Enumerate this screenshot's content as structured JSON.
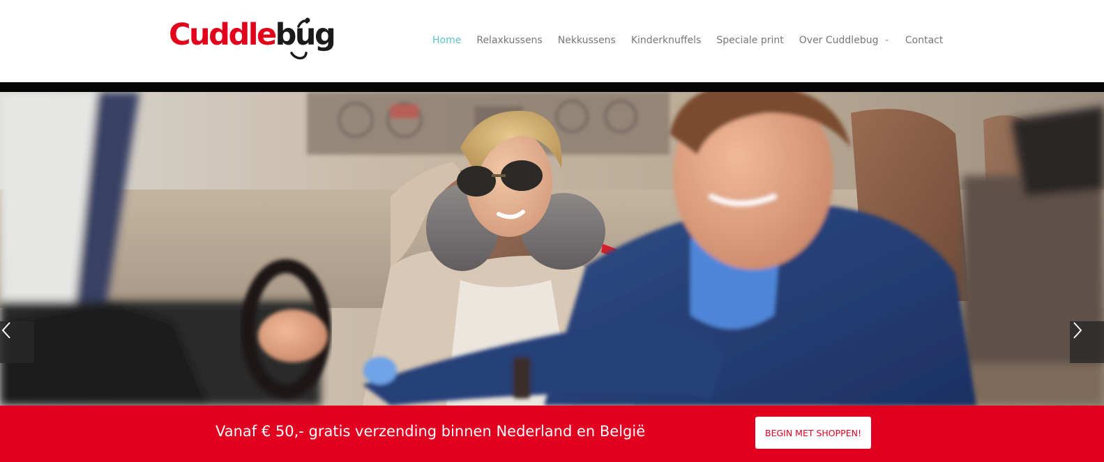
{
  "brand": {
    "logo_part1": "Cuddle",
    "logo_part2": "bug",
    "color_red": "#e2001a",
    "color_dark": "#1a1a1a"
  },
  "nav": {
    "items": [
      {
        "label": "Home",
        "active": true
      },
      {
        "label": "Relaxkussens"
      },
      {
        "label": "Nekkussens"
      },
      {
        "label": "Kinderknuffels"
      },
      {
        "label": "Speciale print"
      },
      {
        "label": "Over Cuddlebug",
        "dropdown": true
      },
      {
        "label": "Contact"
      }
    ],
    "active_color": "#5bc0c0",
    "text_color": "#777777"
  },
  "hero": {
    "icons": {
      "prev": "chevron-left-icon",
      "next": "chevron-right-icon"
    }
  },
  "promo": {
    "text": "Vanaf € 50,- gratis verzending binnen Nederland en België",
    "button_label": "BEGIN MET SHOPPEN!",
    "background": "#e10020"
  }
}
